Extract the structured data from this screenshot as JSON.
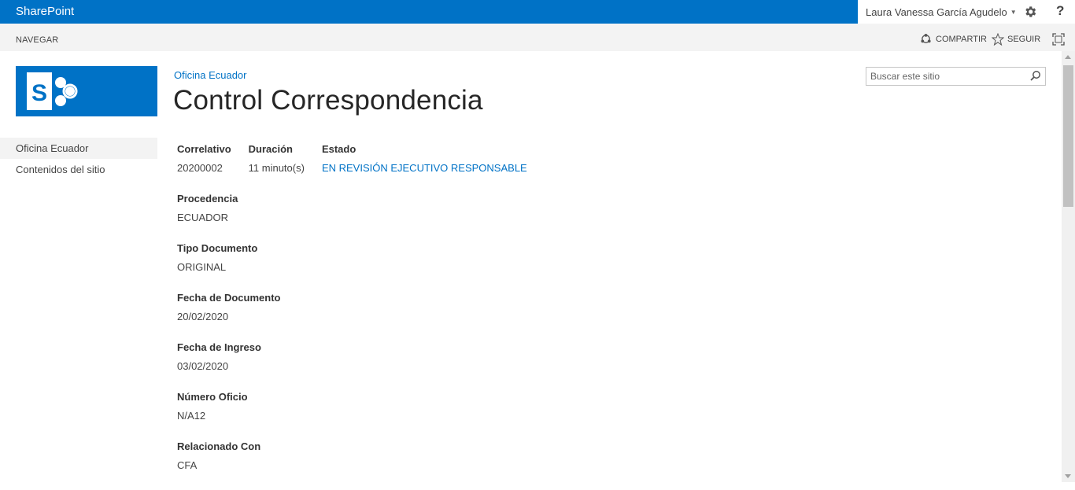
{
  "suitebar": {
    "brand": "SharePoint",
    "user_name": "Laura Vanessa García Agudelo",
    "gear_icon": "gear-icon",
    "help_label": "?"
  },
  "ribbon": {
    "navigate": "NAVEGAR",
    "share": "COMPARTIR",
    "follow": "SEGUIR"
  },
  "header": {
    "breadcrumb": "Oficina Ecuador",
    "title": "Control Correspondencia"
  },
  "search": {
    "placeholder": "Buscar este sitio"
  },
  "quicklaunch": {
    "items": [
      {
        "label": "Oficina Ecuador",
        "selected": true
      },
      {
        "label": "Contenidos del sitio",
        "selected": false
      }
    ]
  },
  "details": {
    "correlativo": {
      "label": "Correlativo",
      "value": "20200002"
    },
    "duracion": {
      "label": "Duración",
      "value": "11 minuto(s)"
    },
    "estado": {
      "label": "Estado",
      "value": "EN REVISIÓN EJECUTIVO RESPONSABLE"
    },
    "procedencia": {
      "label": "Procedencia",
      "value": "ECUADOR"
    },
    "tipo_documento": {
      "label": "Tipo Documento",
      "value": "ORIGINAL"
    },
    "fecha_documento": {
      "label": "Fecha de Documento",
      "value": "20/02/2020"
    },
    "fecha_ingreso": {
      "label": "Fecha de Ingreso",
      "value": "03/02/2020"
    },
    "numero_oficio": {
      "label": "Número Oficio",
      "value": "N/A12"
    },
    "relacionado_con": {
      "label": "Relacionado Con",
      "value": "CFA"
    }
  },
  "colors": {
    "brand_blue": "#0072c6",
    "ribbon_bg": "#f3f3f3"
  }
}
